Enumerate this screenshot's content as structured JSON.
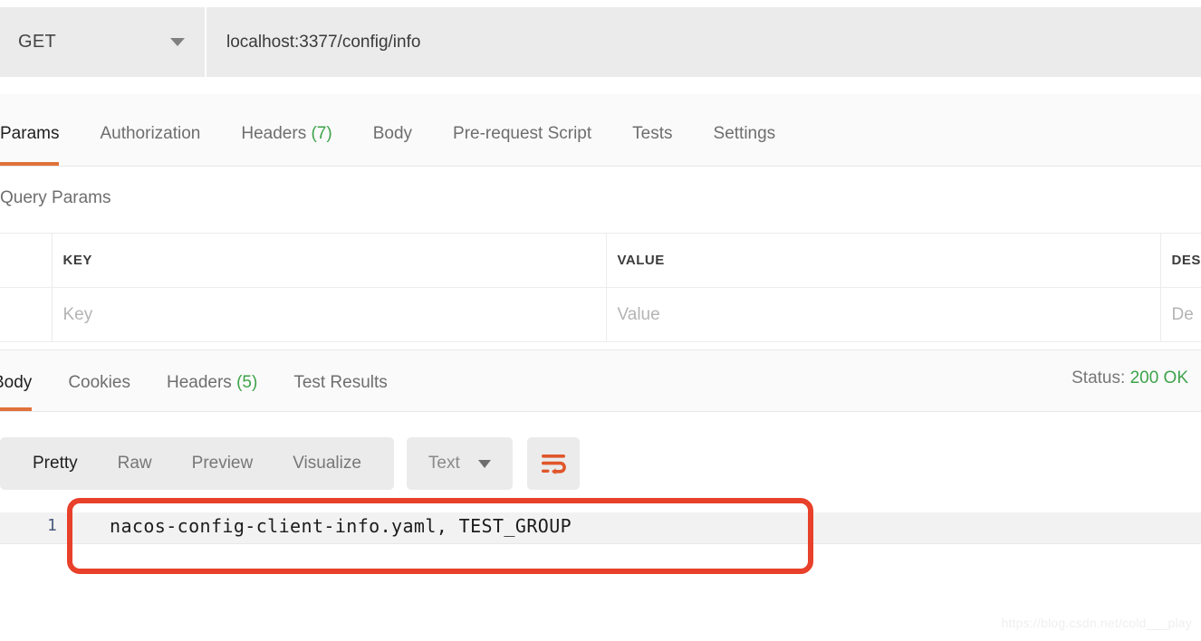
{
  "request": {
    "method": "GET",
    "method_caret_icon": "chevron-down-icon",
    "url": "localhost:3377/config/info"
  },
  "request_tabs": [
    {
      "label": "Params",
      "count": "",
      "active": true
    },
    {
      "label": "Authorization",
      "count": "",
      "active": false
    },
    {
      "label": "Headers",
      "count": "(7)",
      "active": false
    },
    {
      "label": "Body",
      "count": "",
      "active": false
    },
    {
      "label": "Pre-request Script",
      "count": "",
      "active": false
    },
    {
      "label": "Tests",
      "count": "",
      "active": false
    },
    {
      "label": "Settings",
      "count": "",
      "active": false
    }
  ],
  "query_params": {
    "title": "Query Params",
    "columns": [
      "",
      "KEY",
      "VALUE",
      "DES"
    ],
    "rows": [
      {
        "check": "",
        "key_placeholder": "Key",
        "value_placeholder": "Value",
        "desc_placeholder": "De"
      }
    ]
  },
  "response_tabs": [
    {
      "label": "Body",
      "count": "",
      "active": true
    },
    {
      "label": "Cookies",
      "count": "",
      "active": false
    },
    {
      "label": "Headers",
      "count": "(5)",
      "active": false
    },
    {
      "label": "Test Results",
      "count": "",
      "active": false
    }
  ],
  "status": {
    "label": "Status:",
    "value": "200 OK"
  },
  "view_toolbar": {
    "modes": [
      {
        "label": "Pretty",
        "active": true
      },
      {
        "label": "Raw",
        "active": false
      },
      {
        "label": "Preview",
        "active": false
      },
      {
        "label": "Visualize",
        "active": false
      }
    ],
    "format_select": {
      "value": "Text",
      "caret_icon": "chevron-down-icon"
    },
    "wrap_button_icon": "wrap-lines-icon"
  },
  "response_body": {
    "line_number": "1",
    "text": "nacos-config-client-info.yaml, TEST_GROUP"
  },
  "watermark": "https://blog.csdn.net/cold___play",
  "colors": {
    "accent": "#e0713a",
    "status_ok": "#3ea34a",
    "highlight_box": "#e8402a",
    "chrome_grey": "#ebebeb"
  }
}
